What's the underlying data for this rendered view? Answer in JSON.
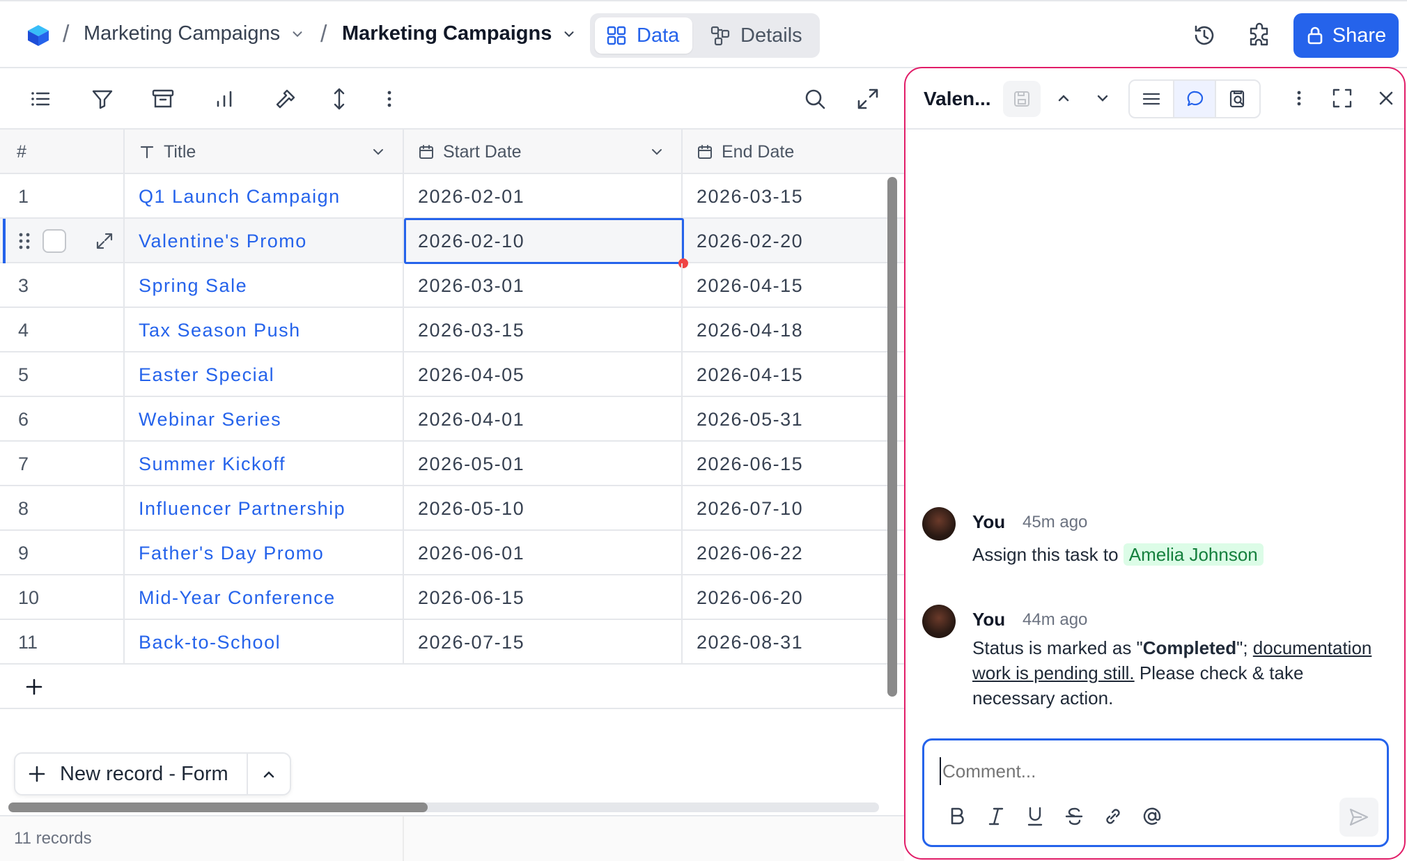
{
  "breadcrumb": {
    "base": "Marketing Campaigns",
    "table": "Marketing Campaigns"
  },
  "view_switch": {
    "data_label": "Data",
    "details_label": "Details"
  },
  "share_label": "Share",
  "columns": {
    "num": "#",
    "title": "Title",
    "start": "Start Date",
    "end": "End Date"
  },
  "rows": [
    {
      "num": "1",
      "title": "Q1 Launch Campaign",
      "start": "2026-02-01",
      "end": "2026-03-15"
    },
    {
      "num": "",
      "title": "Valentine's Promo",
      "start": "2026-02-10",
      "end": "2026-02-20"
    },
    {
      "num": "3",
      "title": "Spring Sale",
      "start": "2026-03-01",
      "end": "2026-04-15"
    },
    {
      "num": "4",
      "title": "Tax Season Push",
      "start": "2026-03-15",
      "end": "2026-04-18"
    },
    {
      "num": "5",
      "title": "Easter Special",
      "start": "2026-04-05",
      "end": "2026-04-15"
    },
    {
      "num": "6",
      "title": "Webinar Series",
      "start": "2026-04-01",
      "end": "2026-05-31"
    },
    {
      "num": "7",
      "title": "Summer Kickoff",
      "start": "2026-05-01",
      "end": "2026-06-15"
    },
    {
      "num": "8",
      "title": "Influencer Partnership",
      "start": "2026-05-10",
      "end": "2026-07-10"
    },
    {
      "num": "9",
      "title": "Father's Day Promo",
      "start": "2026-06-01",
      "end": "2026-06-22"
    },
    {
      "num": "10",
      "title": "Mid-Year Conference",
      "start": "2026-06-15",
      "end": "2026-06-20"
    },
    {
      "num": "11",
      "title": "Back-to-School",
      "start": "2026-07-15",
      "end": "2026-08-31"
    }
  ],
  "new_record_label": "New record - Form",
  "records_count": "11 records",
  "panel": {
    "title": "Valen...",
    "comments": [
      {
        "author": "You",
        "time": "45m ago",
        "text_before": "Assign this task to ",
        "mention": "Amelia Johnson"
      },
      {
        "author": "You",
        "time": "44m ago",
        "text_a": "Status is marked as \"",
        "bold": "Completed",
        "text_b": "\"; ",
        "underlined": "documentation work is pending still.",
        "text_c": " Please check & take necessary action."
      }
    ],
    "comment_placeholder": "Comment..."
  },
  "colors": {
    "accent": "#2563eb",
    "panel_border": "#e11d68",
    "mention_bg": "#dcfce7",
    "mention_text": "#15803d",
    "active_cell_handle": "#ef4444"
  }
}
